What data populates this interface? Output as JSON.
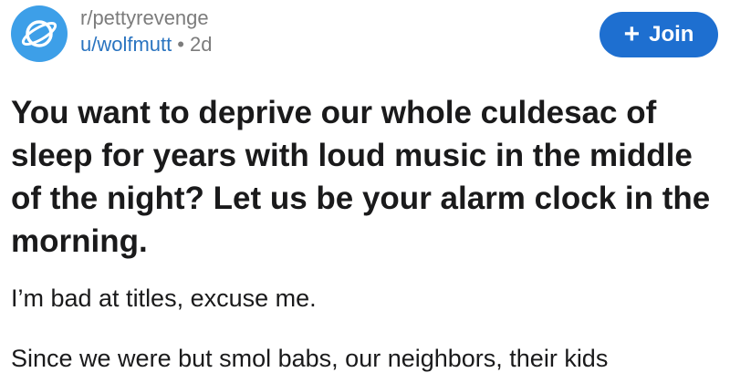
{
  "header": {
    "subreddit": "r/pettyrevenge",
    "username": "u/wolfmutt",
    "separator": "•",
    "age": "2d",
    "avatar_icon": "planet-icon",
    "join_label": "Join",
    "join_icon": "plus-icon"
  },
  "post": {
    "title": "You want to deprive our whole culdesac of sleep for years with loud music in the middle of the night? Let us be your alarm clock in the morning.",
    "paragraphs": [
      "I’m bad at titles, excuse me.",
      "Since we were but smol babs, our neighbors, their kids"
    ]
  },
  "colors": {
    "accent": "#1e6fd0",
    "avatar": "#3d9fe8",
    "username": "#2a74c0",
    "muted": "#7c7c7c"
  }
}
